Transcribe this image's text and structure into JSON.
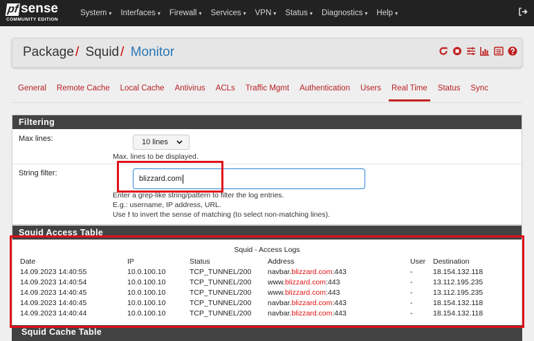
{
  "navbar": {
    "brand_pf": "pf",
    "brand_sense": "sense",
    "brand_sub": "COMMUNITY EDITION",
    "menu": [
      {
        "label": "System"
      },
      {
        "label": "Interfaces"
      },
      {
        "label": "Firewall"
      },
      {
        "label": "Services"
      },
      {
        "label": "VPN"
      },
      {
        "label": "Status"
      },
      {
        "label": "Diagnostics"
      },
      {
        "label": "Help"
      }
    ],
    "caret": "▾",
    "logout_icon": "sign-out-icon"
  },
  "breadcrumb": {
    "part1": "Package",
    "part2": "Squid",
    "part3": "Monitor",
    "sep": "/",
    "icons": [
      "refresh-icon",
      "stop-icon",
      "sliders-icon",
      "chart-icon",
      "list-icon",
      "help-icon"
    ]
  },
  "tabs": [
    {
      "label": "General"
    },
    {
      "label": "Remote Cache"
    },
    {
      "label": "Local Cache"
    },
    {
      "label": "Antivirus"
    },
    {
      "label": "ACLs"
    },
    {
      "label": "Traffic Mgmt"
    },
    {
      "label": "Authentication"
    },
    {
      "label": "Users"
    },
    {
      "label": "Real Time"
    },
    {
      "label": "Status"
    },
    {
      "label": "Sync"
    }
  ],
  "active_tab": "Real Time",
  "filtering": {
    "heading": "Filtering",
    "max_lines_label": "Max lines:",
    "max_lines_value": "10 lines",
    "max_lines_help": "Max. lines to be displayed.",
    "string_filter_label": "String filter:",
    "string_filter_value": "blizzard.com",
    "help1": "Enter a grep-like string/pattern to filter the log entries.",
    "help2": "E.g.: username, IP address, URL.",
    "help3_pre": "Use ",
    "help3_bang": "!",
    "help3_post": " to invert the sense of matching (to select non-matching lines)."
  },
  "access_table": {
    "heading": "Squid Access Table",
    "title": "Squid - Access Logs",
    "columns": [
      "Date",
      "IP",
      "Status",
      "Address",
      "User",
      "Destination"
    ],
    "rows": [
      {
        "date": "14.09.2023 14:40:55",
        "ip": "10.0.100.10",
        "status": "TCP_TUNNEL/200",
        "addr_pre": "navbar.",
        "addr_hl": "blizzard.com",
        "addr_post": ":443",
        "user": "-",
        "dest": "18.154.132.118"
      },
      {
        "date": "14.09.2023 14:40:54",
        "ip": "10.0.100.10",
        "status": "TCP_TUNNEL/200",
        "addr_pre": "www.",
        "addr_hl": "blizzard.com",
        "addr_post": ":443",
        "user": "-",
        "dest": "13.112.195.235"
      },
      {
        "date": "14.09.2023 14:40:45",
        "ip": "10.0.100.10",
        "status": "TCP_TUNNEL/200",
        "addr_pre": "www.",
        "addr_hl": "blizzard.com",
        "addr_post": ":443",
        "user": "-",
        "dest": "13.112.195.235"
      },
      {
        "date": "14.09.2023 14:40:45",
        "ip": "10.0.100.10",
        "status": "TCP_TUNNEL/200",
        "addr_pre": "navbar.",
        "addr_hl": "blizzard.com",
        "addr_post": ":443",
        "user": "-",
        "dest": "18.154.132.118"
      },
      {
        "date": "14.09.2023 14:40:44",
        "ip": "10.0.100.10",
        "status": "TCP_TUNNEL/200",
        "addr_pre": "navbar.",
        "addr_hl": "blizzard.com",
        "addr_post": ":443",
        "user": "-",
        "dest": "18.154.132.118"
      }
    ]
  },
  "cache_table": {
    "heading": "Squid Cache Table"
  },
  "colors": {
    "navbar_bg": "#222222",
    "panel_heading_bg": "#424242",
    "tab_red": "#b81e24",
    "active_crumb": "#2a77b5",
    "highlight": "#e01010",
    "annotation": "#e0101a"
  }
}
